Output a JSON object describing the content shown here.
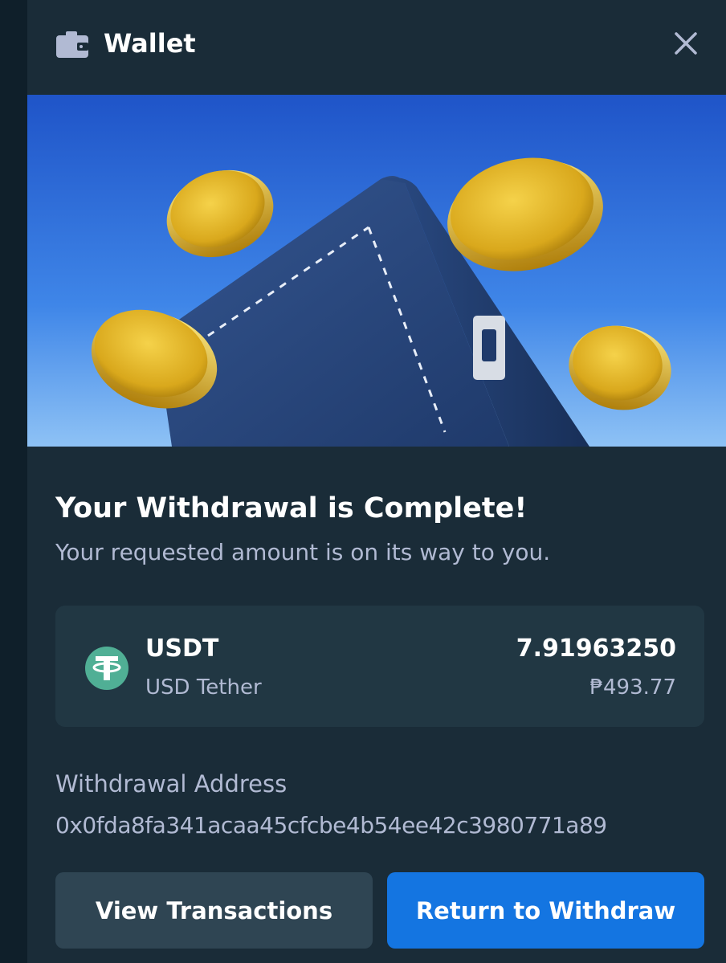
{
  "header": {
    "title": "Wallet",
    "icon": "wallet-icon",
    "close_icon": "close-icon"
  },
  "banner": {
    "image": "wallet-with-gold-coins-illustration"
  },
  "main": {
    "title": "Your Withdrawal is Complete!",
    "subtitle": "Your requested amount is on its way to you."
  },
  "currency_card": {
    "icon": "tether-icon",
    "symbol": "USDT",
    "name": "USD Tether",
    "amount": "7.91963250",
    "fiat_amount": "₱493.77"
  },
  "address": {
    "label": "Withdrawal Address",
    "value": "0x0fda8fa341acaa45cfcbe4b54ee42c3980771a89"
  },
  "actions": {
    "view_transactions": "View Transactions",
    "return_to_withdraw": "Return to Withdraw"
  },
  "colors": {
    "panel_bg": "#1a2c38",
    "card_bg": "#213743",
    "secondary_button": "#2f4553",
    "primary_button": "#1475e1",
    "muted_text": "#b1bad3",
    "tether_green": "#50af95"
  }
}
